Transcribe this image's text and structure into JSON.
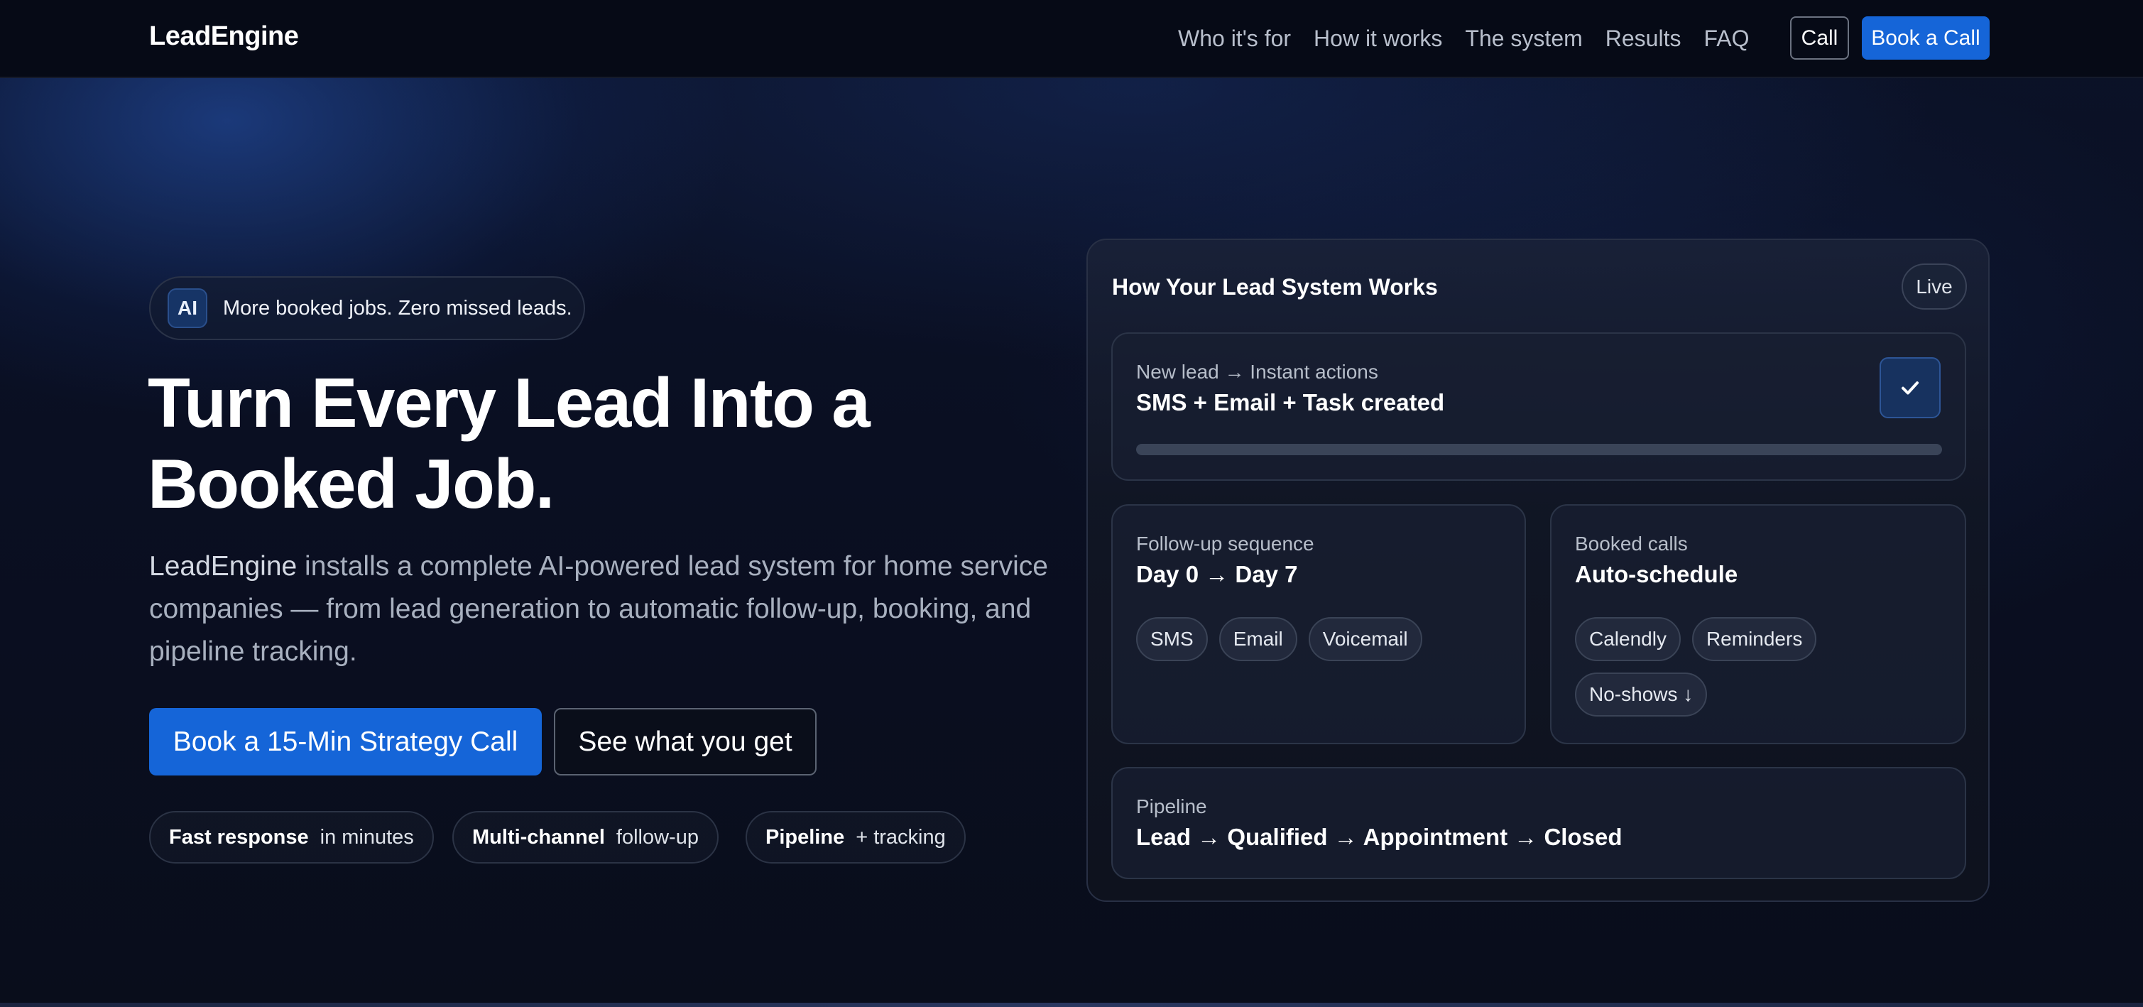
{
  "nav": {
    "logo": "LeadEngine",
    "links": [
      "Who it's for",
      "How it works",
      "The system",
      "Results",
      "FAQ"
    ],
    "call_label": "Call",
    "book_label": "Book a Call"
  },
  "hero": {
    "badge_icon_text": "AI",
    "badge_text": "More booked jobs. Zero missed leads.",
    "headline_line1": "Turn Every Lead Into a",
    "headline_line2": "Booked Job.",
    "subtext_brand": "LeadEngine",
    "subtext_rest": " installs a complete AI-powered lead system for home service companies — from lead generation to automatic follow-up, booking, and pipeline tracking.",
    "primary_button": "Book a 15-Min Strategy Call",
    "secondary_button": "See what you get",
    "pills": [
      {
        "strong": "Fast response",
        "light": "in minutes"
      },
      {
        "strong": "Multi-channel",
        "light": "follow-up"
      },
      {
        "strong": "Pipeline",
        "light": "+ tracking"
      }
    ]
  },
  "system_card": {
    "title": "How Your Lead System Works",
    "live_label": "Live",
    "new_lead": {
      "label": "New lead → Instant actions",
      "value": "SMS + Email + Task created",
      "check_icon": "checkmark-icon",
      "progress": 1.0
    },
    "followup": {
      "label": "Follow-up sequence",
      "value": "Day 0 → Day 7",
      "chips": [
        "SMS",
        "Email",
        "Voicemail"
      ]
    },
    "booked": {
      "label": "Booked calls",
      "value": "Auto-schedule",
      "chips": [
        "Calendly",
        "Reminders",
        "No-shows ↓"
      ]
    },
    "pipeline": {
      "label": "Pipeline",
      "value": "Lead → Qualified → Appointment → Closed"
    }
  },
  "colors": {
    "accent": "#1565d8",
    "background": "#0a0e1a",
    "nav_background": "#060a16"
  }
}
